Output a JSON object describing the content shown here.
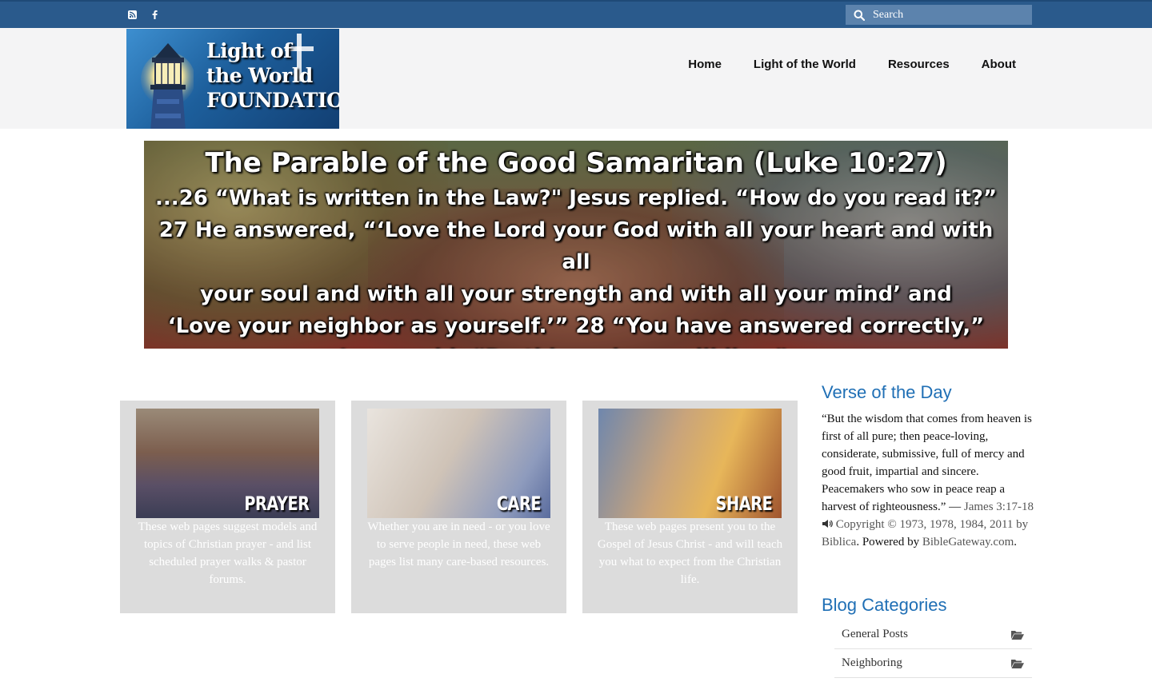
{
  "topbar": {
    "icons": [
      "rss-icon",
      "facebook-icon"
    ],
    "search_placeholder": "Search",
    "bg_color": "#2a5a8c"
  },
  "header": {
    "logo_lines": [
      "Light of",
      "the World",
      "FOUNDATION"
    ],
    "nav": [
      "Home",
      "Light of the World",
      "Resources",
      "About"
    ]
  },
  "banner": {
    "title": "The Parable of the Good Samaritan (Luke 10:27)",
    "lines": [
      "...26 “What is written in the Law?\" Jesus replied. “How do you read it?”",
      "27 He answered, “‘Love the Lord your God with all your heart and with all",
      "your soul and with all your strength and with all your mind’ and",
      "‘Love your neighbor as yourself.’” 28 “You have answered correctly,”",
      "Jesus said. “Do this and you will live.”..."
    ]
  },
  "cards": [
    {
      "label": "PRAYER",
      "desc": "These web pages suggest models and topics of Christian prayer - and list scheduled prayer walks & pastor forums."
    },
    {
      "label": "CARE",
      "desc": "Whether you are in need - or you love to serve people in need, these web pages list many care-based resources."
    },
    {
      "label": "SHARE",
      "desc": "These web pages present you to the Gospel of Jesus Christ - and will teach you what to expect from the Christian life."
    }
  ],
  "sidebar": {
    "verse_heading": "Verse of the Day",
    "verse_text": "“But the wisdom that comes from heaven is first of all pure; then peace-loving, considerate, submissive, full of mercy and good fruit, impartial and sincere. Peacemakers who sow in peace reap a harvest of righteousness.” —",
    "verse_ref": "James 3:17-18",
    "copyright": "Copyright © 1973, 1978, 1984, 2011 by Biblica",
    "powered_prefix": ". Powered by",
    "powered_link": "BibleGateway.com",
    "powered_suffix": ".",
    "categories_heading": "Blog Categories",
    "categories": [
      "General Posts",
      "Neighboring"
    ]
  }
}
